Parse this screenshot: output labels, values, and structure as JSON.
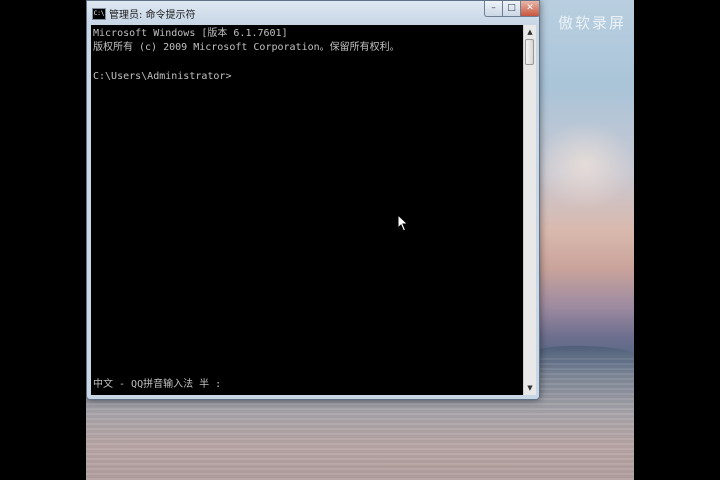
{
  "desktop": {
    "watermark": "傲软录屏"
  },
  "window": {
    "title": "管理员: 命令提示符",
    "icon_label": "C:\\",
    "controls": {
      "minimize": "–",
      "maximize": "□",
      "close": "✕"
    }
  },
  "console": {
    "lines": [
      "Microsoft Windows [版本 6.1.7601]",
      "版权所有 (c) 2009 Microsoft Corporation。保留所有权利。",
      "C:\\Users\\Administrator>"
    ],
    "ime_status": "中文 - QQ拼音输入法 半 :"
  },
  "scrollbar": {
    "up_arrow": "▲",
    "down_arrow": "▼"
  },
  "icons": {
    "window_icon": "cmd-icon",
    "cursor": "mouse-pointer-icon"
  }
}
